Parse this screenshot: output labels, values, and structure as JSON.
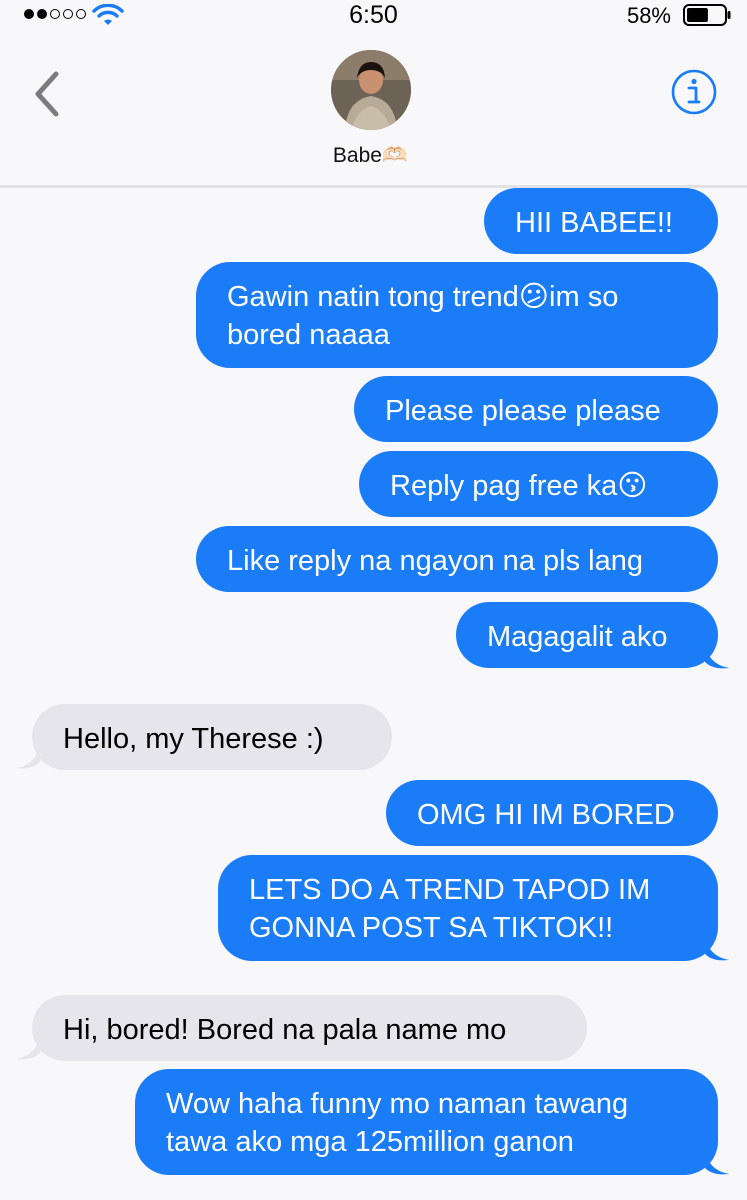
{
  "status_bar": {
    "time": "6:50",
    "battery": "58%",
    "signal_strength": 2,
    "signal_max": 5,
    "battery_level": 0.58
  },
  "header": {
    "contact_name": "Babe🫶🏻"
  },
  "messages": [
    {
      "direction": "outgoing",
      "text": "HII BABEE!!"
    },
    {
      "direction": "outgoing",
      "text": "Gawin natin tong trend😕im so bored naaaa"
    },
    {
      "direction": "outgoing",
      "text": "Please please please"
    },
    {
      "direction": "outgoing",
      "text": "Reply pag free ka😗"
    },
    {
      "direction": "outgoing",
      "text": "Like reply na ngayon na pls lang"
    },
    {
      "direction": "outgoing",
      "text": "Magagalit ako"
    },
    {
      "direction": "incoming",
      "text": "Hello, my Therese :)"
    },
    {
      "direction": "outgoing",
      "text": "OMG HI IM BORED"
    },
    {
      "direction": "outgoing",
      "text": "LETS DO A TREND TAPOD IM GONNA POST SA TIKTOK!!"
    },
    {
      "direction": "incoming",
      "text": "Hi, bored! Bored na pala name mo"
    },
    {
      "direction": "outgoing",
      "text": "Wow haha funny mo naman tawang tawa ako mga 125million ganon"
    }
  ],
  "colors": {
    "outgoing_bubble": "#1a7cf6",
    "incoming_bubble": "#e6e5eb",
    "accent": "#1a7cf6"
  },
  "icons": {
    "back": "chevron-left-icon",
    "info": "info-icon",
    "wifi": "wifi-icon",
    "battery": "battery-icon"
  }
}
